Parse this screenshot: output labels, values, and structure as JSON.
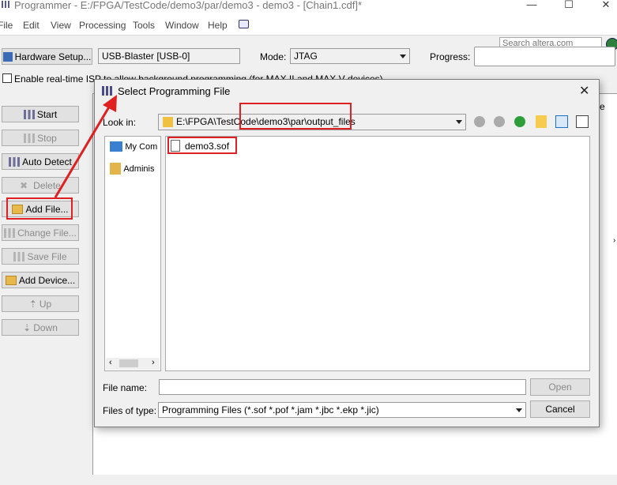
{
  "window": {
    "title": "Programmer - E:/FPGA/TestCode/demo3/par/demo3 - demo3 - [Chain1.cdf]*",
    "minimize": "—",
    "maximize": "☐",
    "close": "✕"
  },
  "menu": [
    "File",
    "Edit",
    "View",
    "Processing",
    "Tools",
    "Window",
    "Help"
  ],
  "search": {
    "placeholder": "Search altera.com"
  },
  "toolbar": {
    "hardware_setup": "Hardware Setup...",
    "hardware_value": "USB-Blaster [USB-0]",
    "mode_label": "Mode:",
    "mode_value": "JTAG",
    "progress_label": "Progress:",
    "isp_checkbox_label": "Enable real-time ISP to allow background programming (for MAX II and MAX V devices)"
  },
  "side_buttons": {
    "start": "Start",
    "stop": "Stop",
    "auto_detect": "Auto Detect",
    "delete": "Delete",
    "add_file": "Add File...",
    "change_file": "Change File...",
    "save_file": "Save File",
    "add_device": "Add Device...",
    "up": "Up",
    "down": "Down"
  },
  "dialog": {
    "title": "Select Programming File",
    "close": "✕",
    "look_in_label": "Look in:",
    "look_in_value": "E:\\FPGA\\TestCode\\demo3\\par\\output_files",
    "places": [
      "My Com",
      "Adminis"
    ],
    "files": [
      "demo3.sof"
    ],
    "file_name_label": "File name:",
    "file_name_value": "",
    "files_of_type_label": "Files of type:",
    "files_of_type_value": "Programming Files (*.sof *.pof *.jam *.jbc *.ekp *.jic)",
    "open": "Open",
    "cancel": "Cancel"
  },
  "colors": {
    "annotation_red": "#e02020",
    "accent": "#1a6fd0"
  }
}
